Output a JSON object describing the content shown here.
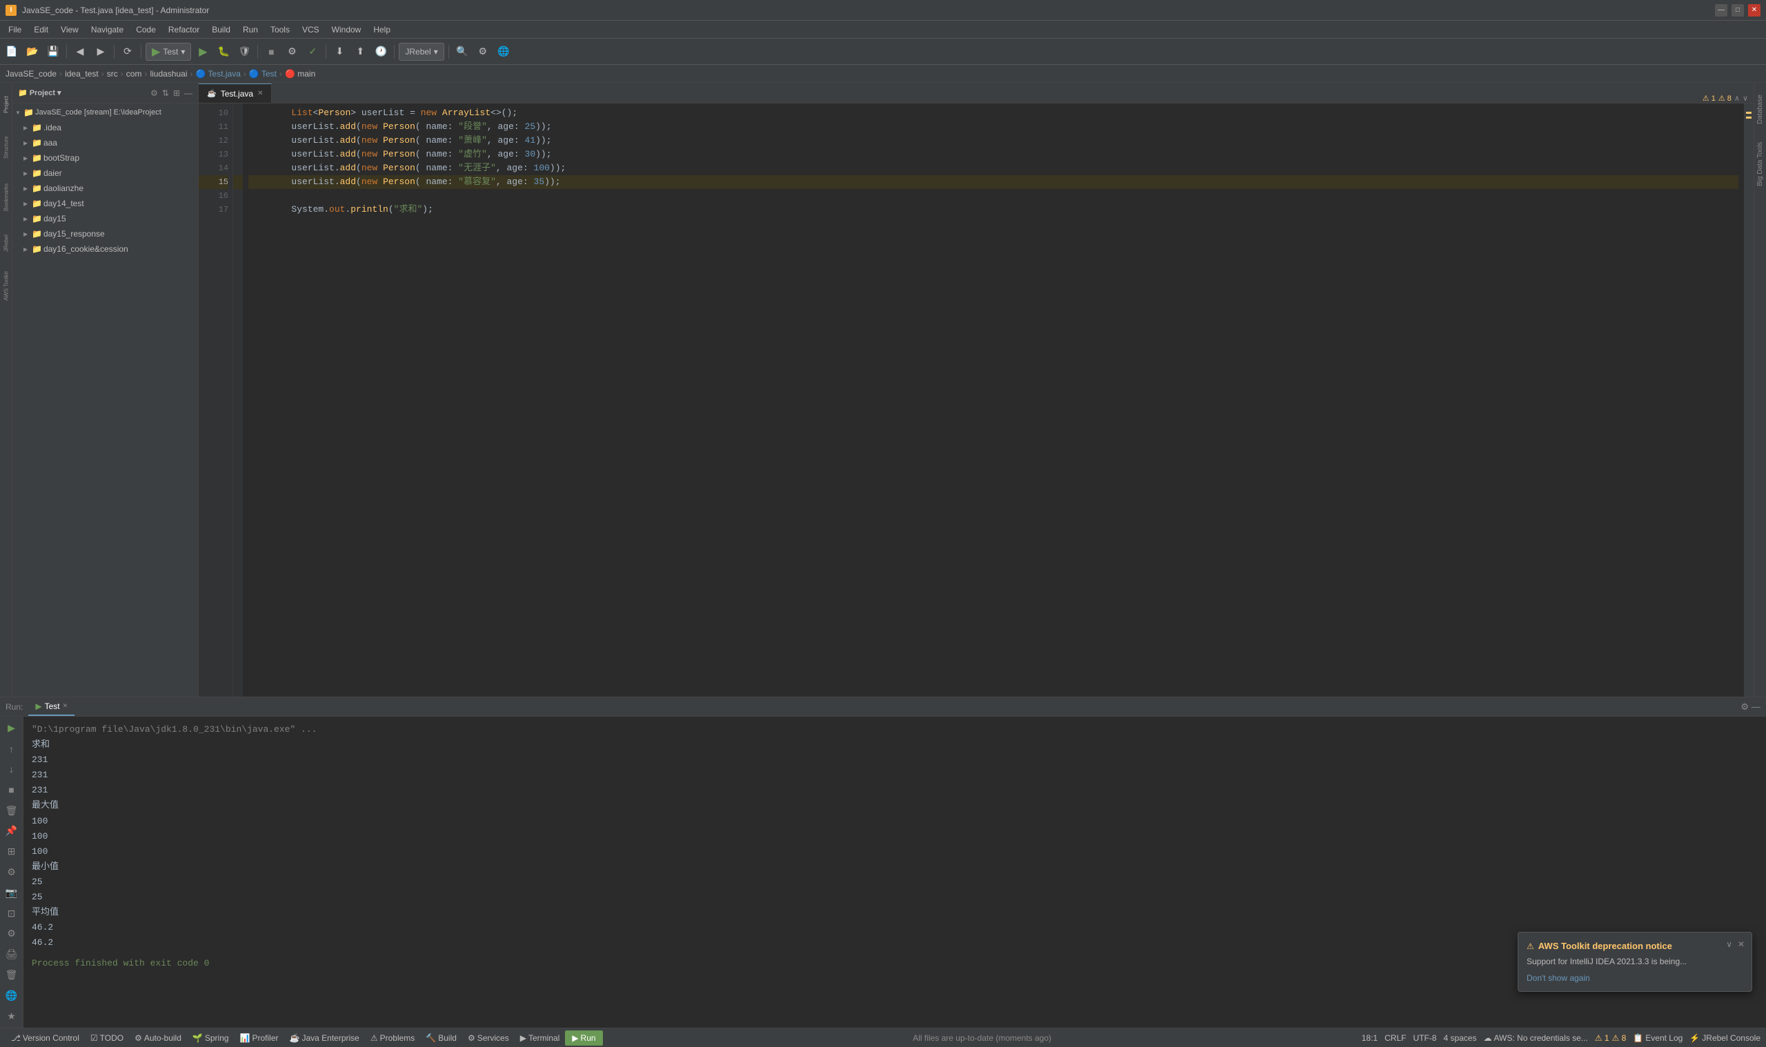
{
  "titlebar": {
    "title": "JavaSE_code - Test.java [idea_test] - Administrator",
    "minimize": "—",
    "maximize": "□",
    "close": "✕"
  },
  "menubar": {
    "items": [
      "File",
      "Edit",
      "View",
      "Navigate",
      "Code",
      "Refactor",
      "Build",
      "Run",
      "Tools",
      "VCS",
      "Window",
      "Help"
    ]
  },
  "toolbar": {
    "run_config": "Test",
    "jrebel_btn": "JRebel"
  },
  "breadcrumb": {
    "items": [
      "JavaSE_code",
      "idea_test",
      "src",
      "com",
      "liudashuai",
      "Test.java",
      "Test",
      "main"
    ]
  },
  "sidebar": {
    "title": "Project",
    "root": "JavaSE_code [stream] E:\\IdeaProject",
    "items": [
      {
        "label": ".idea",
        "type": "folder",
        "level": 1
      },
      {
        "label": "aaa",
        "type": "folder",
        "level": 1
      },
      {
        "label": "bootStrap",
        "type": "folder",
        "level": 1
      },
      {
        "label": "daier",
        "type": "folder",
        "level": 1
      },
      {
        "label": "daolianzhe",
        "type": "folder",
        "level": 1
      },
      {
        "label": "day14_test",
        "type": "folder",
        "level": 1
      },
      {
        "label": "day15",
        "type": "folder",
        "level": 1
      },
      {
        "label": "day15_response",
        "type": "folder",
        "level": 1
      },
      {
        "label": "day16_cookie&cession",
        "type": "folder",
        "level": 1
      }
    ]
  },
  "editor": {
    "tab": "Test.java",
    "lines": [
      {
        "num": 10,
        "content": "        List<Person> userList = new ArrayList<>();"
      },
      {
        "num": 11,
        "content": "        userList.add(new Person( name: \"段誉\", age: 25));"
      },
      {
        "num": 12,
        "content": "        userList.add(new Person( name: \"萧峰\", age: 41));"
      },
      {
        "num": 13,
        "content": "        userList.add(new Person( name: \"虚竹\", age: 30));"
      },
      {
        "num": 14,
        "content": "        userList.add(new Person( name: \"无涯子\", age: 100));"
      },
      {
        "num": 15,
        "content": "        userList.add(new Person( name: \"慕容复\", age: 35));"
      },
      {
        "num": 16,
        "content": ""
      },
      {
        "num": 17,
        "content": "        System.out.println(\"求和\");"
      }
    ],
    "highlighted_line": 15
  },
  "run_panel": {
    "label": "Run:",
    "tab": "Test",
    "console": {
      "cmd": "\"D:\\1program file\\Java\\jdk1.8.0_231\\bin\\java.exe\" ...",
      "output": [
        {
          "type": "label",
          "text": "求和"
        },
        {
          "type": "value",
          "text": "231"
        },
        {
          "type": "value",
          "text": "231"
        },
        {
          "type": "value",
          "text": "231"
        },
        {
          "type": "label",
          "text": "最大值"
        },
        {
          "type": "value",
          "text": "100"
        },
        {
          "type": "value",
          "text": "100"
        },
        {
          "type": "value",
          "text": "100"
        },
        {
          "type": "label",
          "text": "最小值"
        },
        {
          "type": "value",
          "text": "25"
        },
        {
          "type": "value",
          "text": "25"
        },
        {
          "type": "label",
          "text": "平均值"
        },
        {
          "type": "value",
          "text": "46.2"
        },
        {
          "type": "value",
          "text": "46.2"
        },
        {
          "type": "process",
          "text": "Process finished with exit code 0"
        }
      ]
    }
  },
  "notification": {
    "title": "AWS Toolkit deprecation notice",
    "body": "Support for IntelliJ IDEA 2021.3.3 is being...",
    "link": "Don't show again"
  },
  "statusbar": {
    "version_control": "Version Control",
    "todo": "TODO",
    "auto_build": "Auto-build",
    "spring": "Spring",
    "profiler": "Profiler",
    "java_enterprise": "Java Enterprise",
    "problems": "Problems",
    "build": "Build",
    "services": "Services",
    "terminal": "Terminal",
    "run": "Run",
    "position": "18:1",
    "line_ending": "CRLF",
    "encoding": "UTF-8",
    "indent": "4 spaces",
    "aws": "AWS: No credentials se...",
    "event_log": "Event Log",
    "jrebel_console": "JRebel Console",
    "warnings": "1",
    "errors": "8",
    "status_msg": "All files are up-to-date (moments ago)"
  },
  "colors": {
    "accent": "#6897bb",
    "run_green": "#6a9956",
    "warning": "#ffc66d",
    "error": "#ff6b6b",
    "bg_dark": "#2b2b2b",
    "bg_medium": "#3c3f41",
    "bg_light": "#4c5052"
  }
}
